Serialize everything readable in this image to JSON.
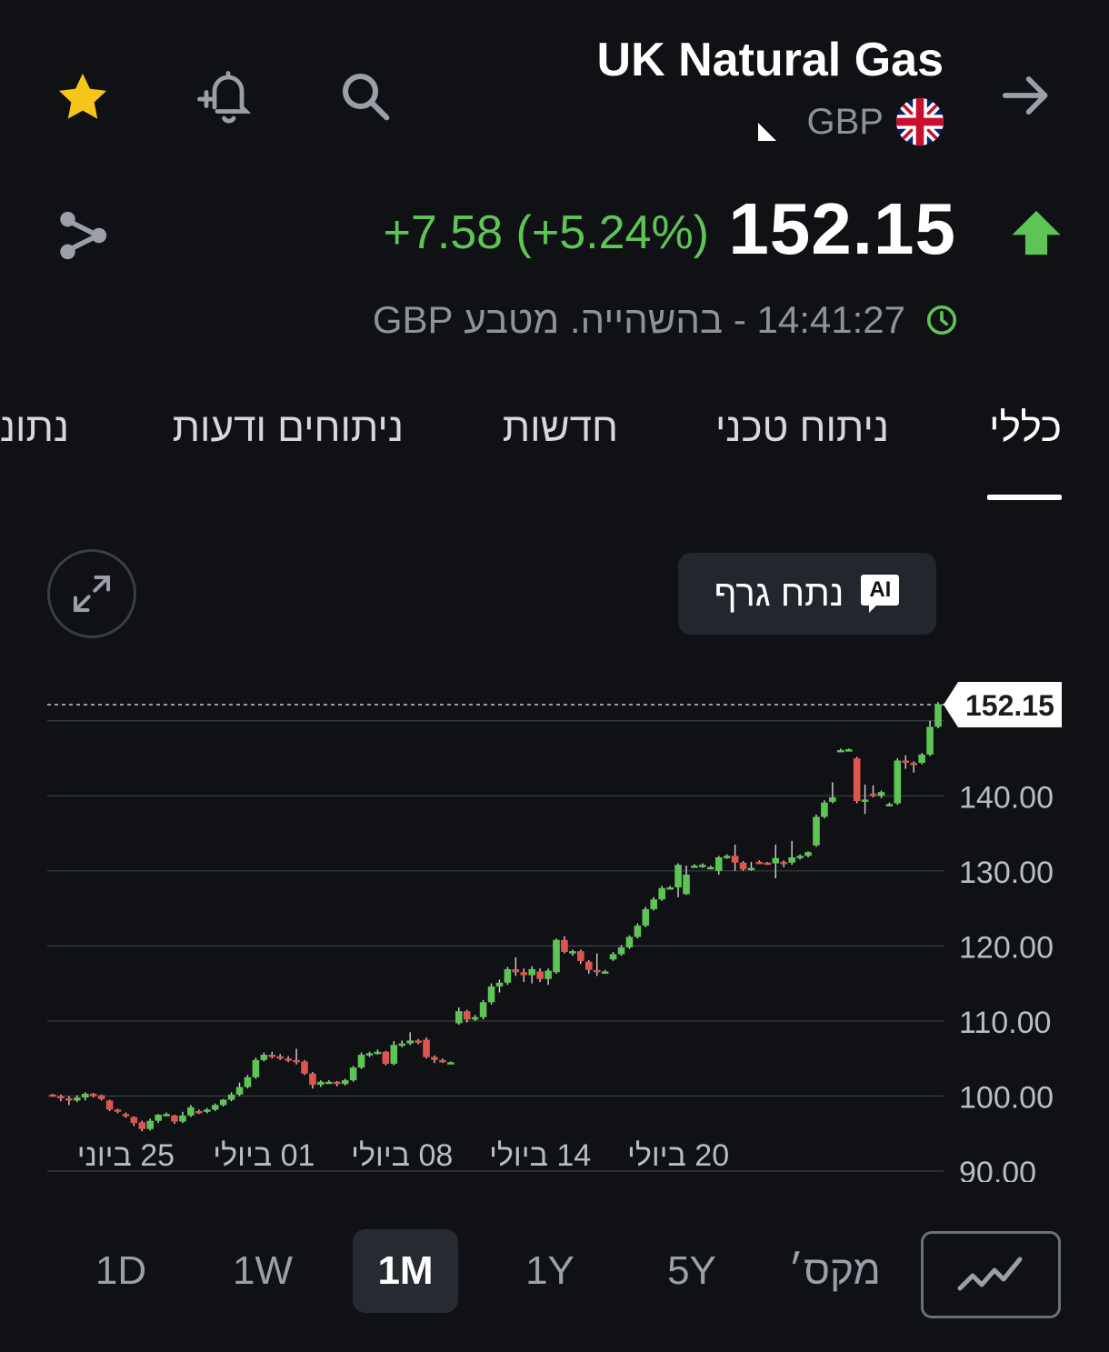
{
  "header": {
    "title": "UK Natural Gas",
    "currency": "GBP",
    "star_color": "#f5c518"
  },
  "quote": {
    "price": "152.15",
    "change": "+7.58 (+5.24%)",
    "direction": "up",
    "up_color": "#5ec456",
    "status": "14:41:27 - בהשהייה. מטבע GBP"
  },
  "tabs": [
    {
      "label": "כללי",
      "active": true
    },
    {
      "label": "ניתוח טכני",
      "active": false
    },
    {
      "label": "חדשות",
      "active": false
    },
    {
      "label": "ניתוחים ודעות",
      "active": false
    },
    {
      "label": "נתונ",
      "active": false
    }
  ],
  "chart_controls": {
    "ai_button_label": "נתח גרף",
    "ai_badge": "AI"
  },
  "chart_data": {
    "type": "candlestick",
    "current_price_label": "152.15",
    "y_ticks": [
      "140.00",
      "130.00",
      "120.00",
      "110.00",
      "100.00",
      "90.00"
    ],
    "y_tick_values": [
      140,
      130,
      120,
      110,
      100,
      90
    ],
    "ylim": [
      90,
      151
    ],
    "x_ticks": [
      "25 ביוני",
      "01 ביולי",
      "08 ביולי",
      "14 ביולי",
      "20 ביולי"
    ],
    "x_tick_index": [
      9,
      26,
      43,
      60,
      77
    ],
    "grid": true,
    "up_color": "#5ec456",
    "down_color": "#e0544e",
    "candles": [
      [
        100.2,
        100.0,
        100.3,
        99.9
      ],
      [
        100.0,
        99.7,
        100.2,
        99.3
      ],
      [
        99.7,
        99.4,
        100.0,
        98.8
      ],
      [
        99.4,
        99.8,
        100.1,
        99.2
      ],
      [
        99.8,
        100.3,
        100.5,
        99.4
      ],
      [
        100.3,
        100.1,
        100.4,
        99.8
      ],
      [
        100.1,
        99.6,
        100.2,
        99.4
      ],
      [
        99.4,
        98.2,
        99.5,
        98.0
      ],
      [
        98.2,
        97.9,
        98.3,
        97.7
      ],
      [
        97.6,
        97.3,
        97.8,
        97.1
      ],
      [
        97.2,
        96.4,
        97.3,
        96.0
      ],
      [
        96.5,
        95.6,
        96.7,
        95.3
      ],
      [
        95.6,
        96.7,
        97.0,
        95.4
      ],
      [
        96.7,
        97.5,
        97.6,
        96.4
      ],
      [
        97.5,
        97.6,
        97.8,
        97.3
      ],
      [
        97.4,
        96.6,
        97.5,
        96.3
      ],
      [
        96.6,
        97.4,
        97.9,
        96.4
      ],
      [
        97.4,
        98.5,
        98.8,
        97.2
      ],
      [
        98.0,
        97.8,
        98.2,
        97.6
      ],
      [
        98.0,
        98.2,
        98.4,
        97.7
      ],
      [
        98.2,
        98.8,
        99.0,
        98.0
      ],
      [
        98.8,
        99.5,
        99.6,
        98.6
      ],
      [
        99.5,
        100.2,
        100.5,
        99.3
      ],
      [
        100.2,
        101.2,
        101.8,
        100.0
      ],
      [
        101.2,
        102.5,
        102.8,
        101.0
      ],
      [
        102.5,
        104.8,
        105.1,
        102.3
      ],
      [
        104.8,
        105.5,
        105.8,
        104.6
      ],
      [
        105.5,
        105.3,
        105.9,
        105.0
      ],
      [
        105.3,
        105.0,
        105.6,
        104.8
      ],
      [
        105.0,
        104.8,
        105.3,
        104.5
      ],
      [
        104.8,
        104.6,
        106.3,
        104.2
      ],
      [
        104.6,
        103.0,
        104.8,
        102.8
      ],
      [
        103.0,
        101.5,
        103.2,
        101.0
      ],
      [
        101.5,
        101.9,
        102.1,
        101.2
      ],
      [
        101.9,
        101.9,
        102.1,
        101.7
      ],
      [
        101.9,
        101.6,
        102.0,
        101.3
      ],
      [
        101.6,
        102.1,
        102.3,
        101.4
      ],
      [
        102.1,
        103.8,
        104.0,
        101.9
      ],
      [
        103.8,
        105.5,
        105.8,
        103.6
      ],
      [
        105.4,
        105.7,
        105.9,
        105.2
      ],
      [
        105.7,
        105.9,
        106.2,
        105.5
      ],
      [
        105.9,
        104.3,
        106.0,
        104.1
      ],
      [
        104.3,
        106.8,
        107.3,
        104.1
      ],
      [
        106.8,
        107.0,
        107.4,
        106.5
      ],
      [
        107.0,
        107.4,
        108.5,
        106.8
      ],
      [
        107.4,
        107.1,
        107.6,
        106.9
      ],
      [
        107.5,
        105.2,
        107.8,
        105.0
      ],
      [
        105.2,
        104.8,
        105.4,
        104.4
      ],
      [
        104.8,
        104.6,
        105.0,
        104.4
      ],
      [
        104.5,
        104.5,
        104.6,
        104.4
      ],
      [
        109.7,
        111.3,
        111.8,
        109.5
      ],
      [
        111.3,
        110.2,
        111.5,
        109.8
      ],
      [
        110.2,
        110.5,
        110.8,
        110.0
      ],
      [
        110.5,
        112.5,
        112.8,
        110.2
      ],
      [
        112.5,
        114.6,
        115.0,
        112.2
      ],
      [
        114.6,
        115.1,
        115.5,
        113.8
      ],
      [
        115.1,
        116.9,
        117.2,
        114.8
      ],
      [
        116.9,
        116.5,
        118.5,
        116.0
      ],
      [
        116.5,
        116.1,
        117.0,
        115.2
      ],
      [
        116.1,
        116.9,
        117.3,
        115.0
      ],
      [
        116.6,
        115.6,
        117.0,
        115.2
      ],
      [
        115.6,
        116.7,
        117.0,
        114.8
      ],
      [
        116.5,
        120.8,
        121.0,
        116.3
      ],
      [
        120.8,
        119.2,
        121.3,
        119.0
      ],
      [
        119.2,
        119.3,
        119.5,
        118.7
      ],
      [
        119.3,
        118.0,
        119.5,
        117.6
      ],
      [
        117.9,
        116.8,
        118.1,
        116.3
      ],
      [
        116.8,
        116.5,
        119.0,
        116.0
      ],
      [
        116.5,
        116.6,
        116.8,
        116.3
      ],
      [
        118.2,
        118.9,
        119.2,
        118.0
      ],
      [
        118.9,
        119.8,
        120.1,
        118.7
      ],
      [
        119.8,
        121.2,
        121.4,
        119.6
      ],
      [
        121.2,
        122.7,
        123.0,
        121.0
      ],
      [
        122.7,
        124.9,
        125.2,
        122.5
      ],
      [
        124.9,
        126.2,
        126.5,
        124.7
      ],
      [
        126.2,
        127.7,
        128.0,
        126.0
      ],
      [
        127.7,
        127.8,
        128.0,
        127.5
      ],
      [
        127.8,
        130.8,
        131.0,
        126.5
      ],
      [
        126.9,
        129.5,
        130.7,
        126.8
      ],
      [
        130.6,
        130.7,
        130.9,
        130.4
      ],
      [
        130.6,
        130.8,
        131.0,
        130.4
      ],
      [
        130.5,
        130.5,
        130.7,
        130.3
      ],
      [
        130.0,
        131.8,
        132.0,
        129.5
      ],
      [
        131.8,
        132.0,
        132.2,
        131.6
      ],
      [
        132.0,
        131.1,
        133.5,
        130.0
      ],
      [
        131.1,
        130.2,
        131.3,
        130.0
      ],
      [
        130.2,
        130.4,
        131.2,
        130.0
      ],
      [
        131.2,
        131.1,
        131.4,
        130.9
      ],
      [
        131.1,
        131.0,
        131.2,
        130.8
      ],
      [
        131.0,
        131.7,
        133.5,
        129.0
      ],
      [
        131.2,
        131.1,
        131.4,
        130.5
      ],
      [
        131.1,
        131.8,
        134.0,
        130.8
      ],
      [
        131.7,
        132.0,
        132.2,
        131.5
      ],
      [
        132.0,
        132.5,
        132.6,
        131.8
      ],
      [
        133.4,
        137.2,
        137.5,
        133.2
      ],
      [
        137.2,
        139.1,
        139.4,
        137.0
      ],
      [
        139.2,
        139.8,
        141.8,
        139.0
      ],
      [
        146.0,
        146.1,
        146.3,
        145.9
      ],
      [
        146.1,
        146.2,
        146.3,
        146.0
      ],
      [
        145.0,
        139.3,
        145.2,
        139.0
      ],
      [
        139.3,
        139.5,
        141.5,
        137.6
      ],
      [
        140.3,
        140.0,
        141.4,
        139.8
      ],
      [
        140.0,
        140.5,
        140.7,
        139.7
      ],
      [
        138.8,
        138.9,
        139.1,
        138.6
      ],
      [
        139.0,
        144.7,
        145.0,
        138.8
      ],
      [
        144.7,
        144.4,
        145.4,
        143.6
      ],
      [
        144.4,
        144.1,
        144.6,
        143.1
      ],
      [
        144.4,
        145.5,
        145.7,
        144.2
      ],
      [
        145.5,
        149.2,
        150.0,
        145.3
      ],
      [
        149.2,
        152.2,
        152.5,
        149.0
      ]
    ]
  },
  "ranges": [
    {
      "label": "1D",
      "active": false
    },
    {
      "label": "1W",
      "active": false
    },
    {
      "label": "1M",
      "active": true
    },
    {
      "label": "1Y",
      "active": false
    },
    {
      "label": "5Y",
      "active": false
    },
    {
      "label": "מקס׳",
      "active": false
    }
  ],
  "icons": {
    "favorite": "star-icon",
    "alert": "bell-plus-icon",
    "search": "search-icon",
    "back": "arrow-right-icon",
    "share": "share-icon",
    "expand": "expand-icon",
    "chart_type": "line-chart-icon"
  }
}
